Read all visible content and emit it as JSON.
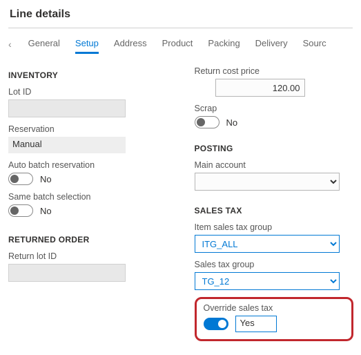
{
  "page": {
    "title": "Line details"
  },
  "tabs": {
    "items": [
      "General",
      "Setup",
      "Address",
      "Product",
      "Packing",
      "Delivery",
      "Sourc"
    ],
    "active_index": 1
  },
  "left": {
    "inventory": {
      "heading": "INVENTORY",
      "lot_id_label": "Lot ID",
      "lot_id_value": "",
      "reservation_label": "Reservation",
      "reservation_value": "Manual",
      "auto_batch_label": "Auto batch reservation",
      "auto_batch_state": "No",
      "same_batch_label": "Same batch selection",
      "same_batch_state": "No"
    },
    "returned_order": {
      "heading": "RETURNED ORDER",
      "return_lot_label": "Return lot ID",
      "return_lot_value": ""
    }
  },
  "right": {
    "return_cost_label": "Return cost price",
    "return_cost_value": "120.00",
    "scrap_label": "Scrap",
    "scrap_state": "No",
    "posting": {
      "heading": "POSTING",
      "main_account_label": "Main account",
      "main_account_value": ""
    },
    "sales_tax": {
      "heading": "SALES TAX",
      "item_group_label": "Item sales tax group",
      "item_group_value": "ITG_ALL",
      "group_label": "Sales tax group",
      "group_value": "TG_12",
      "override_label": "Override sales tax",
      "override_state": "Yes"
    }
  }
}
